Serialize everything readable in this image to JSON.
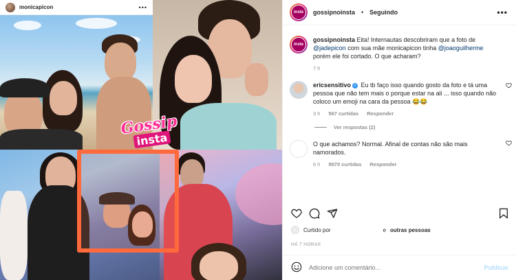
{
  "media": {
    "inner_post_user": "monicapicon",
    "inner_post_more": "•••",
    "logo_line1": "Gossip",
    "logo_line2": "insta"
  },
  "header": {
    "username": "gossipnoinsta",
    "separator": "•",
    "follow_label": "Seguindo",
    "more": "•••",
    "avatar_text": "insta"
  },
  "caption": {
    "username": "gossipnoinsta",
    "text_1": "Eita! Internautas descobriram que a foto de",
    "mention_1": "@jadepicon",
    "text_2": "com sua mãe monicapicon tinha",
    "mention_2": "@joaoguilherme",
    "text_3": "porém ele foi cortado. O que acharam?",
    "time": "7 h"
  },
  "comments": [
    {
      "username": "ericsensitivo",
      "verified": true,
      "text": "Eu tb faço isso quando gosto da foto e tá uma pessoa que não tem mais o porque estar na ali ... isso quando não coloco um emoji na cara da pessoa 😂😂",
      "time": "3 h",
      "likes": "567 curtidas",
      "reply": "Responder",
      "view_replies": "Ver respostas (2)"
    },
    {
      "username": "",
      "text": "O que achamos? Normal. Afinal de contas não são mais namorados.",
      "time": "6 h",
      "likes": "9570 curtidas",
      "reply": "Responder"
    }
  ],
  "likes_line": {
    "prefix": "Curtido por",
    "connector": "e",
    "others": "outras pessoas"
  },
  "post_time": "HÁ 7 HORAS",
  "add_comment": {
    "placeholder": "Adicione um comentário...",
    "publish": "Publicar"
  },
  "colors": {
    "accent_link": "#00376b",
    "muted": "#8e8e8e",
    "publish_disabled": "#b2dffc",
    "verified": "#3897f0"
  }
}
